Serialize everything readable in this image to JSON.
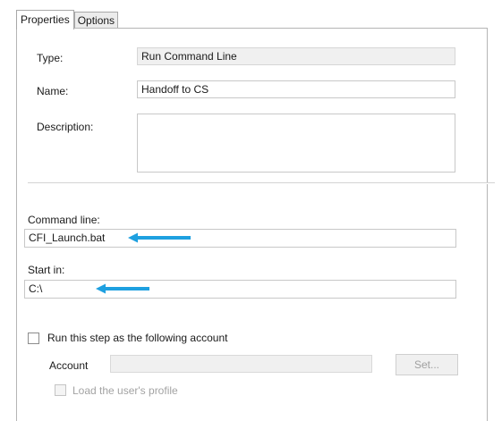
{
  "tabs": [
    {
      "label": "Properties",
      "active": true
    },
    {
      "label": "Options",
      "active": false
    }
  ],
  "type": {
    "label": "Type:",
    "value": "Run Command Line"
  },
  "name": {
    "label": "Name:",
    "value": "Handoff to CS"
  },
  "description": {
    "label": "Description:",
    "value": ""
  },
  "command_line": {
    "label": "Command line:",
    "value": "CFI_Launch.bat"
  },
  "start_in": {
    "label": "Start in:",
    "value": "C:\\"
  },
  "run_as": {
    "label": "Run this step as the following account",
    "checked": false
  },
  "account": {
    "label": "Account",
    "value": "",
    "set_button": "Set..."
  },
  "load_profile": {
    "label": "Load the user's profile",
    "checked": false
  },
  "colors": {
    "arrow": "#1ea0e0"
  }
}
